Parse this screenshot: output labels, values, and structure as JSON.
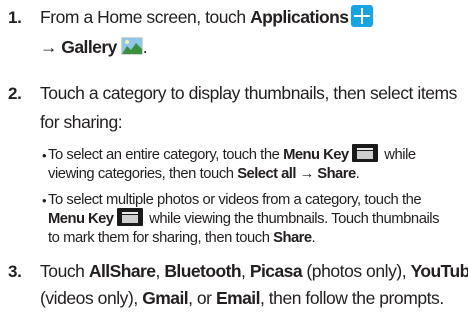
{
  "steps": [
    {
      "number": "1.",
      "line1": {
        "t1": "From a Home screen, touch ",
        "b1": "Applications"
      },
      "line2": {
        "b1": "→ Gallery",
        "t1": "."
      }
    },
    {
      "number": "2.",
      "line1": "Touch a category to display thumbnails, then select items",
      "line2": "for sharing:",
      "bullets": [
        {
          "line1": {
            "t1": "To select an entire category, touch the ",
            "b1": "Menu Key",
            "t2": " while"
          },
          "line2": {
            "t1": "viewing categories, then touch ",
            "b1": "Select all → Share",
            "t2": "."
          }
        },
        {
          "line1": "To select multiple photos or videos from a category, touch the",
          "line2": {
            "b1": "Menu Key",
            "t1": " while viewing the thumbnails. Touch thumbnails"
          },
          "line3": {
            "t1": "to mark them for sharing, then touch ",
            "b1": "Share",
            "t2": "."
          }
        }
      ]
    },
    {
      "number": "3.",
      "line1": {
        "t1": "Touch ",
        "b1": "AllShare",
        "t2": ", ",
        "b2": "Bluetooth",
        "t3": ", ",
        "b3": "Picasa",
        "t4": " (photos only), ",
        "b4": "YouTube"
      },
      "line2": {
        "t1": "(videos only), ",
        "b1": "Gmail",
        "t2": ", or ",
        "b2": "Email",
        "t3": ", then follow the prompts."
      }
    }
  ],
  "bullet_glyph": "•",
  "icons": {
    "applications": "applications-grid-icon",
    "gallery": "gallery-icon",
    "menu_key": "menu-key-icon"
  },
  "colors": {
    "text": "#231f20",
    "applications_icon": "#16a5e2",
    "menu_key_icon": "#1a1a1a"
  }
}
